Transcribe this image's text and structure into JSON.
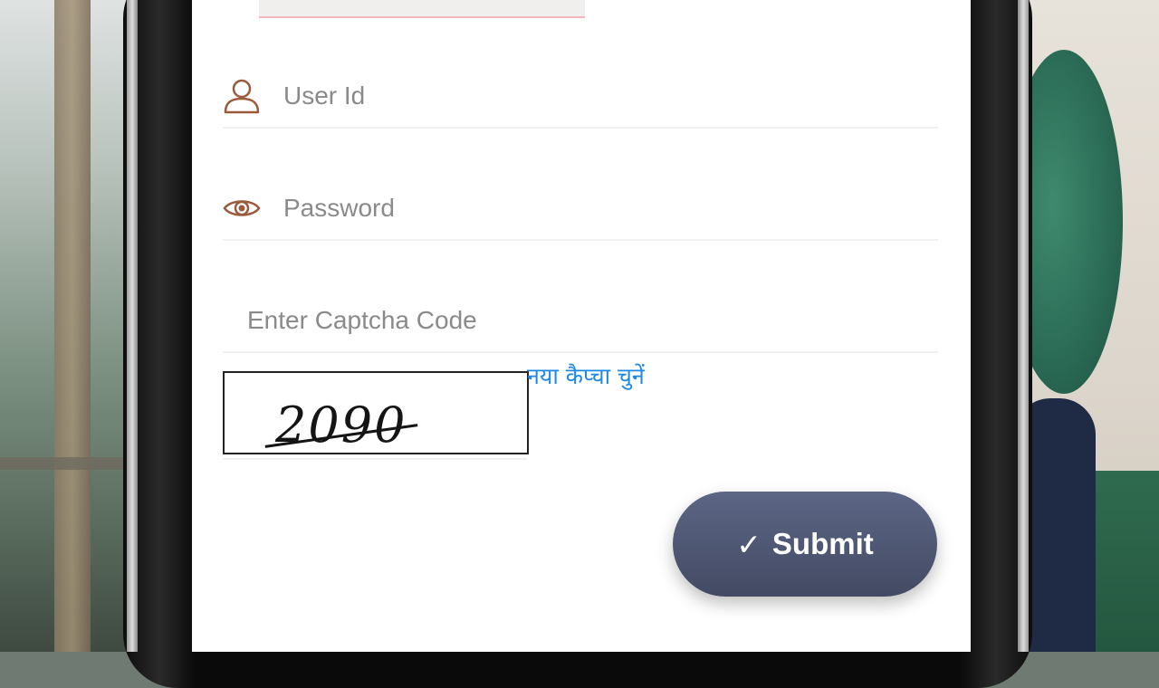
{
  "form": {
    "user_id_placeholder": "User Id",
    "password_placeholder": "Password",
    "captcha_placeholder": "Enter Captcha Code",
    "captcha_value": "2090",
    "new_captcha_link": "नया कैप्चा चुनें",
    "submit_label": "Submit",
    "submit_icon": "check-icon"
  },
  "colors": {
    "icon_brown": "#9c5a3c",
    "link_blue": "#1e88e5",
    "button_dark": "#4b5370"
  }
}
